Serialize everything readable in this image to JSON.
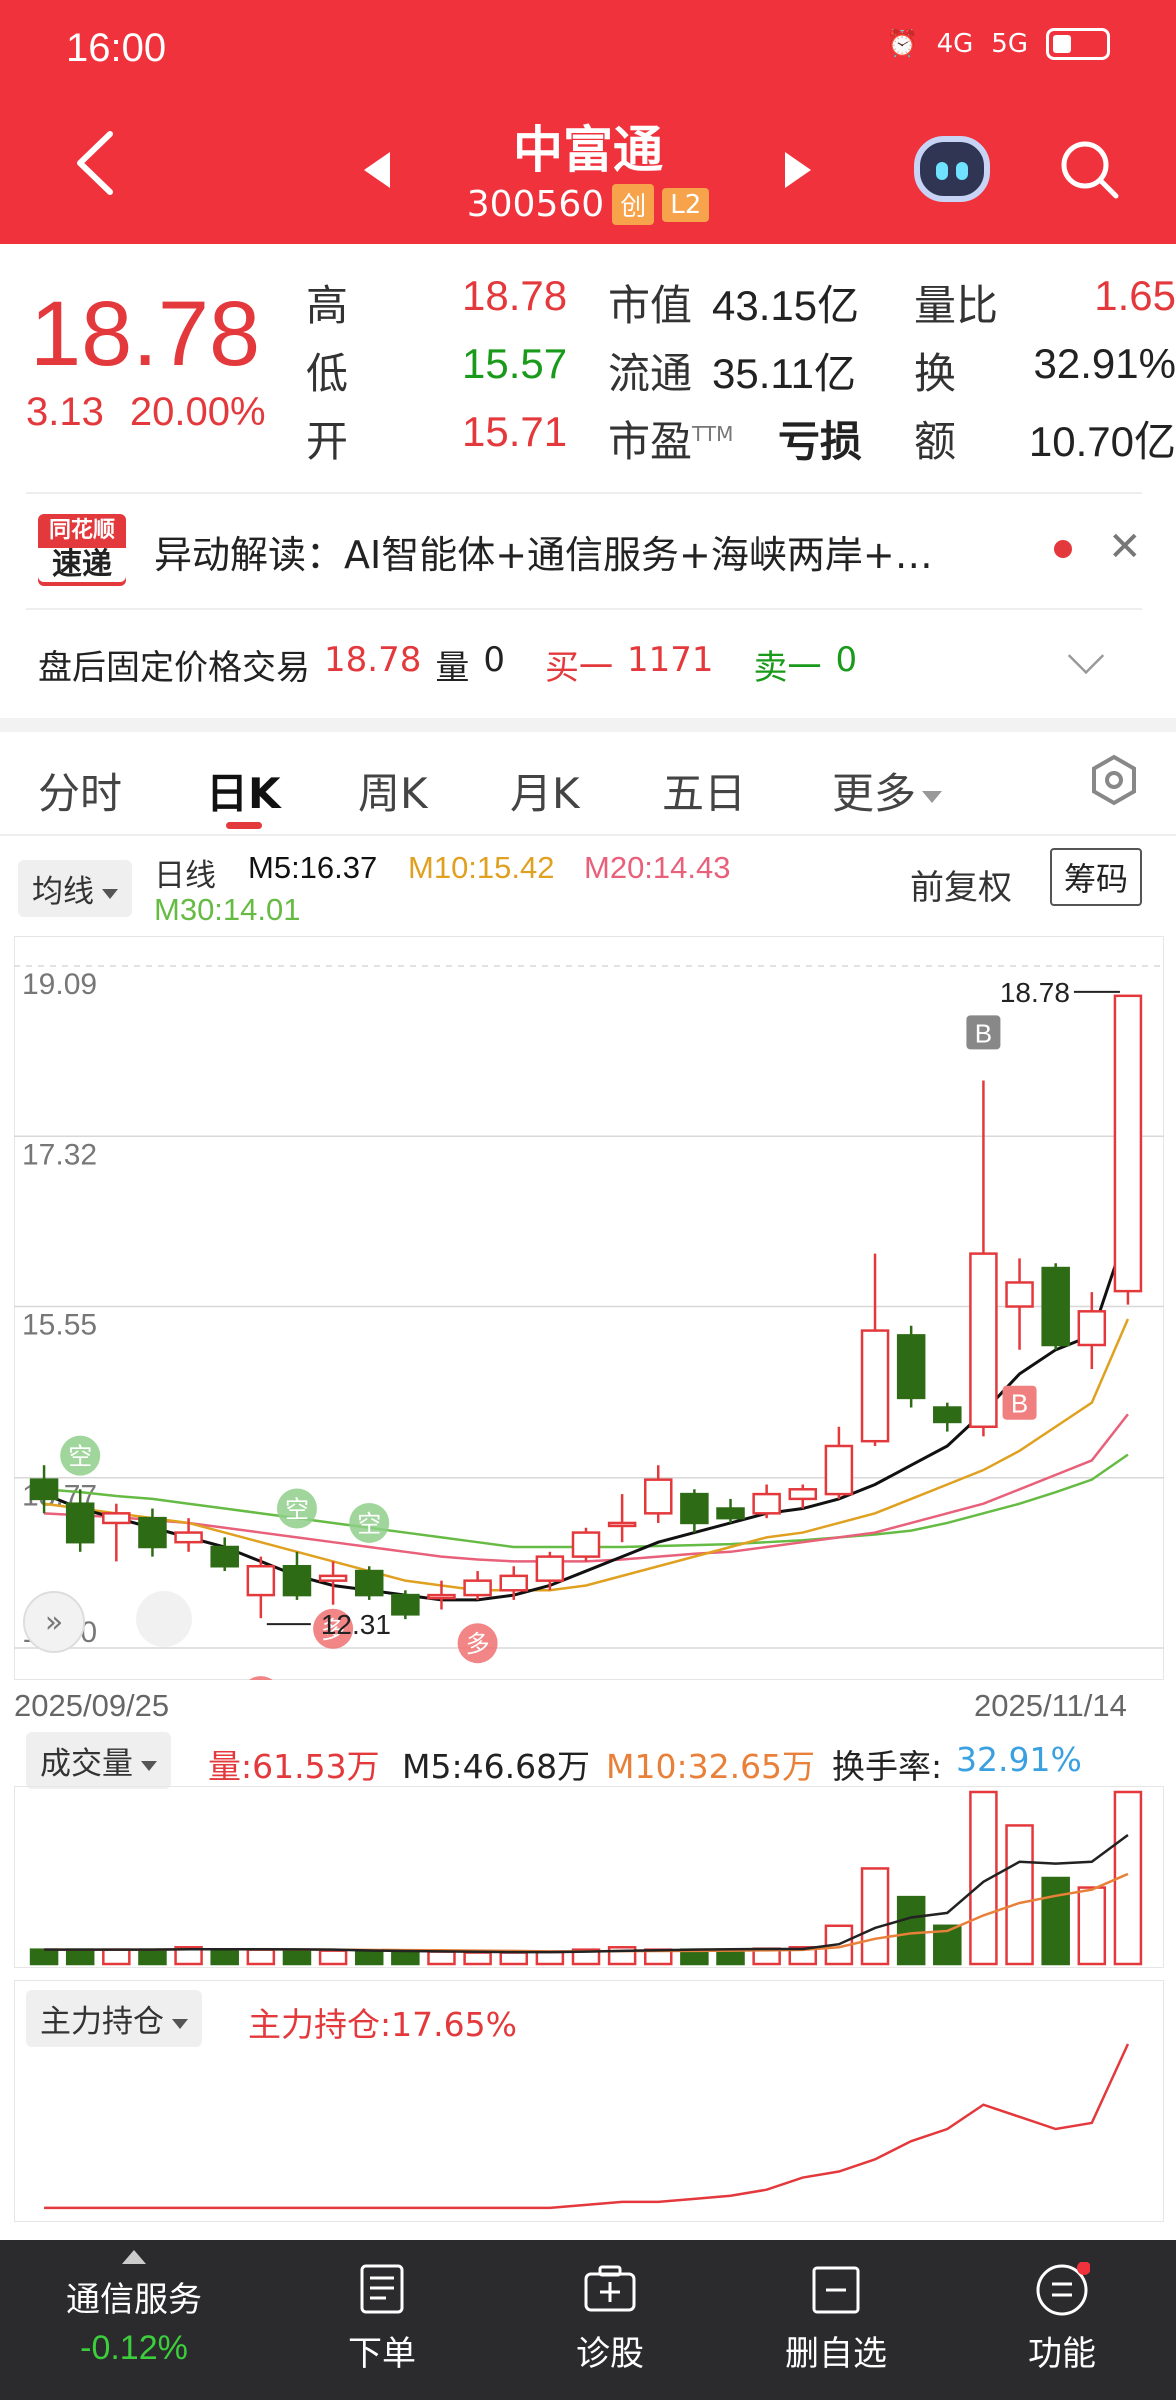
{
  "status": {
    "time": "16:00",
    "net1": "4G",
    "net2": "5G"
  },
  "header": {
    "name": "中富通",
    "code": "300560",
    "tag1": "创",
    "tag2": "L2"
  },
  "quote": {
    "price": "18.78",
    "change": "3.13",
    "pct": "20.00%",
    "high_label": "高",
    "high": "18.78",
    "low_label": "低",
    "low": "15.57",
    "open_label": "开",
    "open": "15.71",
    "mcap_label": "市值",
    "mcap": "43.15亿",
    "float_label": "流通",
    "float": "35.11亿",
    "pe_label": "市盈",
    "pe_sup": "TTM",
    "pe": "亏损",
    "vr_label": "量比",
    "vr": "1.65",
    "turn_label": "换",
    "turn": "32.91%",
    "amt_label": "额",
    "amt": "10.70亿"
  },
  "alert": {
    "logo_top": "同花顺",
    "logo_bottom": "速递",
    "text": "异动解读：AI智能体+通信服务+海峡两岸+…"
  },
  "after_hours": {
    "label": "盘后固定价格交易",
    "price": "18.78",
    "vol_label": "量",
    "vol": "0",
    "buy_label": "买一",
    "buy": "1171",
    "sell_label": "卖一",
    "sell": "0"
  },
  "tabs": [
    "分时",
    "日K",
    "周K",
    "月K",
    "五日",
    "更多"
  ],
  "ma": {
    "selector": "均线",
    "line": "日线",
    "m5": "M5:16.37",
    "m10": "M10:15.42",
    "m20": "M20:14.43",
    "m30": "M30:14.01",
    "adjust": "前复权",
    "chips": "筹码"
  },
  "colors": {
    "up": "#e4393c",
    "down": "#2e6b15",
    "m5": "#111111",
    "m10": "#e0a020",
    "m20": "#e8607a",
    "m30": "#66bb44"
  },
  "chart_data": {
    "type": "candlestick",
    "y_ticks": [
      "19.09",
      "17.32",
      "15.55",
      "13.77",
      "12.00"
    ],
    "ylim": [
      12.0,
      19.09
    ],
    "date_start": "2025/09/25",
    "date_end": "2025/11/14",
    "max_label": "18.78",
    "min_label": "12.31",
    "candles": [
      {
        "o": 13.75,
        "c": 13.55,
        "h": 13.9,
        "l": 13.4
      },
      {
        "o": 13.5,
        "c": 13.1,
        "h": 13.65,
        "l": 13.0
      },
      {
        "o": 13.3,
        "c": 13.4,
        "h": 13.5,
        "l": 12.9
      },
      {
        "o": 13.35,
        "c": 13.05,
        "h": 13.45,
        "l": 12.95
      },
      {
        "o": 13.1,
        "c": 13.2,
        "h": 13.35,
        "l": 13.0
      },
      {
        "o": 13.05,
        "c": 12.85,
        "h": 13.15,
        "l": 12.8
      },
      {
        "o": 12.55,
        "c": 12.85,
        "h": 12.95,
        "l": 12.31
      },
      {
        "o": 12.85,
        "c": 12.55,
        "h": 13.0,
        "l": 12.5
      },
      {
        "o": 12.7,
        "c": 12.75,
        "h": 12.9,
        "l": 12.45
      },
      {
        "o": 12.8,
        "c": 12.55,
        "h": 12.85,
        "l": 12.5
      },
      {
        "o": 12.55,
        "c": 12.35,
        "h": 12.6,
        "l": 12.3
      },
      {
        "o": 12.55,
        "c": 12.55,
        "h": 12.7,
        "l": 12.4
      },
      {
        "o": 12.55,
        "c": 12.7,
        "h": 12.8,
        "l": 12.5
      },
      {
        "o": 12.6,
        "c": 12.75,
        "h": 12.85,
        "l": 12.5
      },
      {
        "o": 12.7,
        "c": 12.95,
        "h": 13.0,
        "l": 12.6
      },
      {
        "o": 12.95,
        "c": 13.2,
        "h": 13.25,
        "l": 12.9
      },
      {
        "o": 13.3,
        "c": 13.3,
        "h": 13.6,
        "l": 13.1
      },
      {
        "o": 13.4,
        "c": 13.75,
        "h": 13.9,
        "l": 13.3
      },
      {
        "o": 13.6,
        "c": 13.3,
        "h": 13.65,
        "l": 13.2
      },
      {
        "o": 13.45,
        "c": 13.35,
        "h": 13.55,
        "l": 13.3
      },
      {
        "o": 13.4,
        "c": 13.6,
        "h": 13.7,
        "l": 13.35
      },
      {
        "o": 13.55,
        "c": 13.65,
        "h": 13.7,
        "l": 13.45
      },
      {
        "o": 13.6,
        "c": 14.1,
        "h": 14.3,
        "l": 13.55
      },
      {
        "o": 14.15,
        "c": 15.3,
        "h": 16.1,
        "l": 14.1
      },
      {
        "o": 15.25,
        "c": 14.6,
        "h": 15.35,
        "l": 14.5
      },
      {
        "o": 14.5,
        "c": 14.35,
        "h": 14.55,
        "l": 14.25
      },
      {
        "o": 14.3,
        "c": 16.1,
        "h": 17.9,
        "l": 14.2
      },
      {
        "o": 15.55,
        "c": 15.8,
        "h": 16.05,
        "l": 15.1
      },
      {
        "o": 15.95,
        "c": 15.15,
        "h": 16.0,
        "l": 15.1
      },
      {
        "o": 15.15,
        "c": 15.5,
        "h": 15.7,
        "l": 14.9
      },
      {
        "o": 15.71,
        "c": 18.78,
        "h": 18.78,
        "l": 15.57
      }
    ],
    "m5": [
      13.6,
      13.45,
      13.35,
      13.25,
      13.15,
      13.05,
      12.9,
      12.75,
      12.65,
      12.6,
      12.55,
      12.5,
      12.5,
      12.55,
      12.65,
      12.8,
      12.95,
      13.1,
      13.2,
      13.3,
      13.4,
      13.45,
      13.55,
      13.7,
      13.9,
      14.1,
      14.45,
      14.85,
      15.1,
      15.25,
      16.37
    ],
    "m10": [
      13.5,
      13.45,
      13.4,
      13.35,
      13.3,
      13.2,
      13.1,
      13.0,
      12.9,
      12.8,
      12.7,
      12.65,
      12.6,
      12.6,
      12.6,
      12.65,
      12.75,
      12.85,
      12.95,
      13.05,
      13.15,
      13.2,
      13.3,
      13.4,
      13.55,
      13.7,
      13.85,
      14.05,
      14.3,
      14.55,
      15.42
    ],
    "m20": [
      13.4,
      13.38,
      13.36,
      13.33,
      13.3,
      13.25,
      13.2,
      13.15,
      13.1,
      13.05,
      13.0,
      12.95,
      12.92,
      12.9,
      12.9,
      12.9,
      12.92,
      12.95,
      12.98,
      13.0,
      13.05,
      13.1,
      13.15,
      13.2,
      13.3,
      13.4,
      13.5,
      13.65,
      13.8,
      13.95,
      14.43
    ],
    "m30": [
      13.65,
      13.62,
      13.58,
      13.55,
      13.5,
      13.45,
      13.4,
      13.35,
      13.3,
      13.25,
      13.2,
      13.15,
      13.1,
      13.05,
      13.05,
      13.05,
      13.05,
      13.06,
      13.07,
      13.08,
      13.1,
      13.12,
      13.15,
      13.18,
      13.22,
      13.3,
      13.4,
      13.5,
      13.62,
      13.75,
      14.01
    ],
    "markers": [
      {
        "idx": 1,
        "text": "空",
        "kind": "sell",
        "price": 14.0
      },
      {
        "idx": 7,
        "text": "空",
        "kind": "sell",
        "price": 13.45
      },
      {
        "idx": 9,
        "text": "空",
        "kind": "sell",
        "price": 13.3
      },
      {
        "idx": 8,
        "text": "多",
        "kind": "buy",
        "price": 12.2
      },
      {
        "idx": 12,
        "text": "多",
        "kind": "buy",
        "price": 12.05
      },
      {
        "idx": 6,
        "text": "多",
        "kind": "buy",
        "price": 11.5
      },
      {
        "idx": 26,
        "text": "B",
        "kind": "b-top",
        "price": 18.4
      },
      {
        "idx": 27,
        "text": "B",
        "kind": "b-bot",
        "price": 14.55
      }
    ]
  },
  "volume": {
    "selector": "成交量",
    "label": "量:61.53万",
    "m5": "M5:46.68万",
    "m10": "M10:32.65万",
    "turn_label": "换手率:",
    "turn": "32.91%",
    "values": [
      3,
      3,
      3,
      3,
      3.5,
      3,
      3,
      2.8,
      2.8,
      2.5,
      2.5,
      2.6,
      2.4,
      2.4,
      2.5,
      3,
      3.5,
      3,
      3,
      3,
      3.2,
      3.5,
      8,
      20,
      14,
      8,
      36,
      29,
      18,
      16,
      36
    ]
  },
  "holdings": {
    "selector": "主力持仓",
    "label": "主力持仓:17.65%",
    "values": [
      1,
      1,
      1,
      1,
      1,
      1,
      1,
      1,
      1,
      1,
      1,
      1,
      1,
      1,
      1,
      1.5,
      2,
      2,
      2.5,
      3,
      4,
      6,
      7,
      9,
      12,
      14,
      18,
      16,
      14,
      15,
      28
    ]
  },
  "bottom": {
    "sector": "通信服务",
    "sector_change": "-0.12%",
    "order": "下单",
    "diagnose": "诊股",
    "remove": "删自选",
    "func": "功能"
  }
}
